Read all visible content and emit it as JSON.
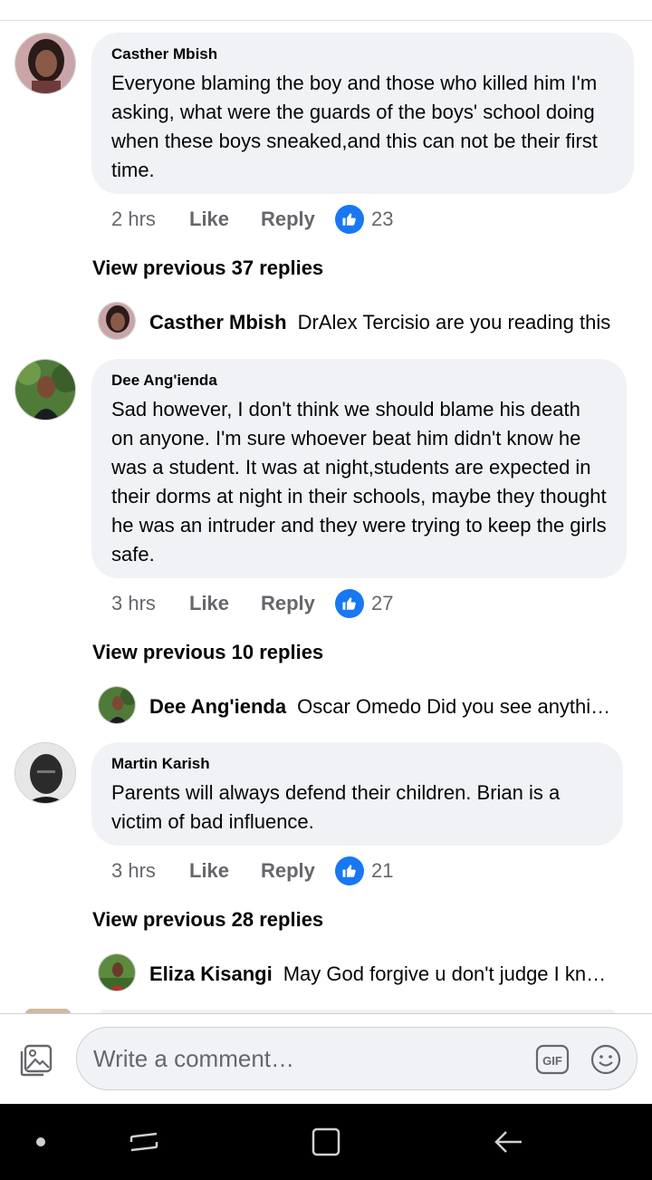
{
  "comments": [
    {
      "author": "Casther Mbish",
      "text": "Everyone blaming the boy and those who killed him I'm asking, what were the guards of the boys' school doing when these boys sneaked,and this can not be their first time.",
      "time": "2 hrs",
      "like_label": "Like",
      "reply_label": "Reply",
      "reaction_count": "23",
      "view_previous": "View previous 37 replies",
      "latest_reply": {
        "author": "Casther Mbish",
        "text": "DrAlex Tercisio are you reading this"
      }
    },
    {
      "author": "Dee Ang'ienda",
      "text": "Sad however, I don't think we should blame his death on anyone. I'm sure whoever beat him didn't know he was a student. It was at night,students are expected in their dorms at night in their schools, maybe they thought he was an intruder and they were trying to keep the girls safe.",
      "time": "3 hrs",
      "like_label": "Like",
      "reply_label": "Reply",
      "reaction_count": "27",
      "view_previous": "View previous 10 replies",
      "latest_reply": {
        "author": "Dee Ang'ienda",
        "text": "Oscar Omedo Did you see anything"
      }
    },
    {
      "author": "Martin Karish",
      "text": "Parents will always defend their children. Brian is a victim of bad influence.",
      "time": "3 hrs",
      "like_label": "Like",
      "reply_label": "Reply",
      "reaction_count": "21",
      "view_previous": "View previous 28 replies",
      "latest_reply": {
        "author": "Eliza Kisangi",
        "text": "May God forgive u  don't judge I know"
      }
    }
  ],
  "composer": {
    "placeholder": "Write a comment…",
    "gif_label": "GIF",
    "photo_icon": "photo-icon",
    "emoji_icon": "emoji-icon"
  },
  "colors": {
    "accent": "#1877f2",
    "bubble": "#f0f2f5",
    "meta_text": "#65676b"
  }
}
